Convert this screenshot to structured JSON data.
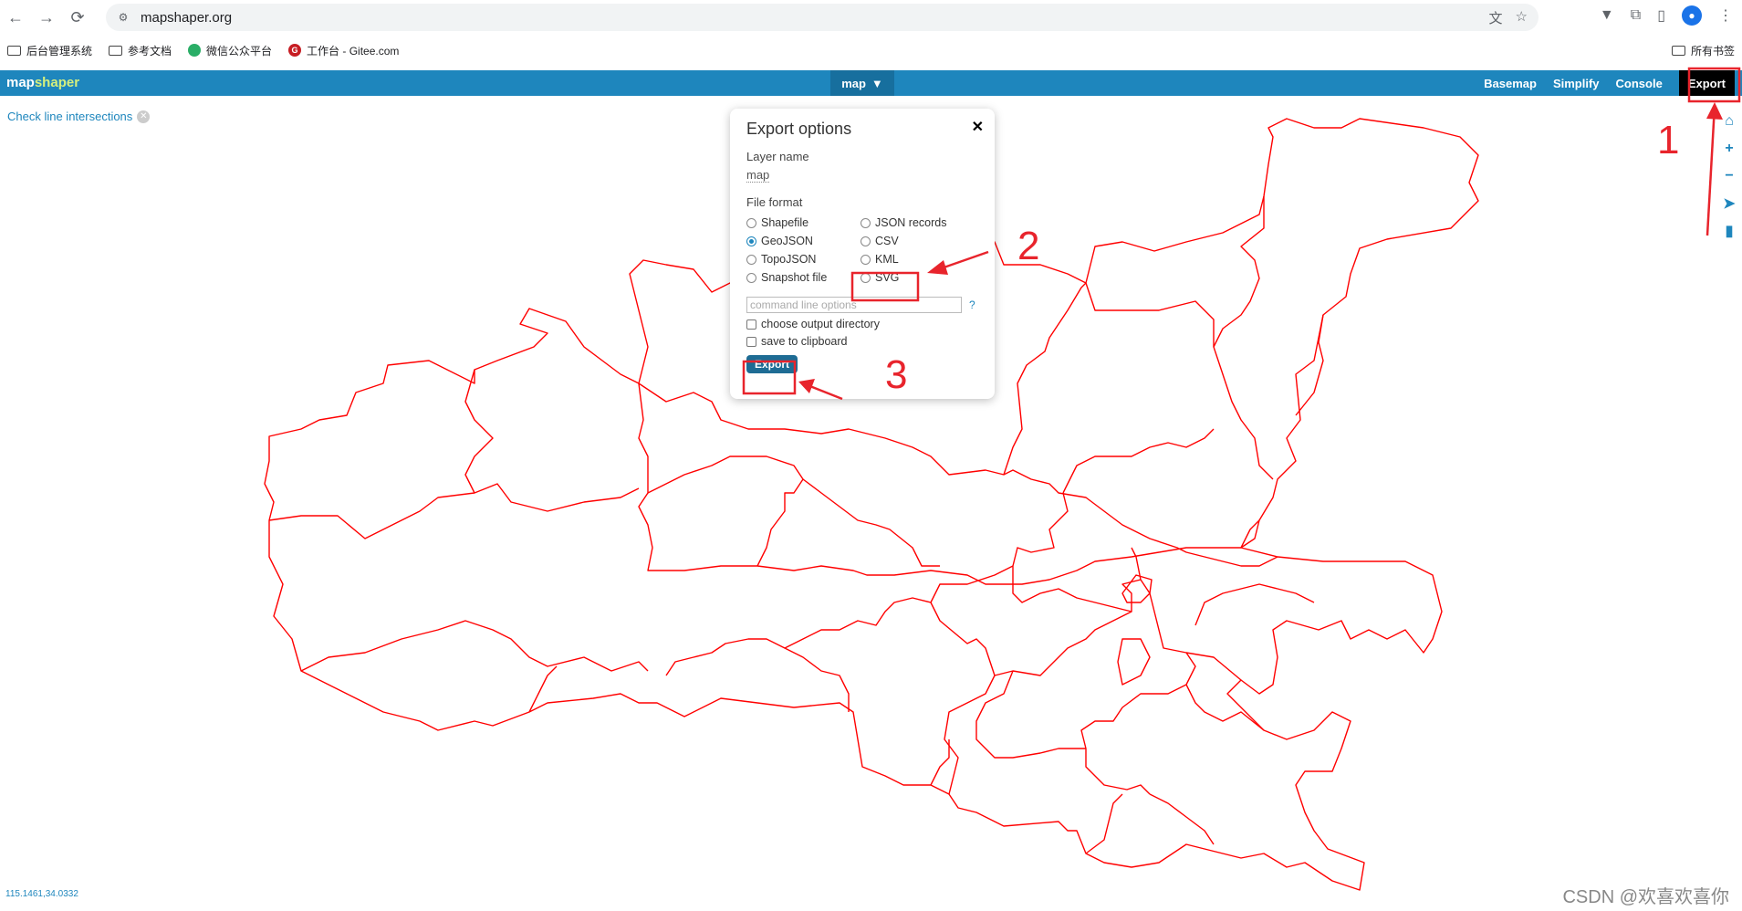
{
  "browser": {
    "url": "mapshaper.org",
    "bookmarks": [
      "后台管理系统",
      "参考文档",
      "微信公众平台",
      "工作台 - Gitee.com"
    ],
    "bookmarks_right": "所有书签"
  },
  "app": {
    "logo_a": "map",
    "logo_b": "shaper",
    "layer_button": "map",
    "menu": {
      "basemap": "Basemap",
      "simplify": "Simplify",
      "console": "Console",
      "export": "Export"
    },
    "check_link": "Check line intersections",
    "coords": "115.1461,34.0332"
  },
  "dialog": {
    "title": "Export options",
    "layer_name_label": "Layer name",
    "layer_name_value": "map",
    "file_format_label": "File format",
    "formats": [
      "Shapefile",
      "JSON records",
      "GeoJSON",
      "CSV",
      "TopoJSON",
      "KML",
      "Snapshot file",
      "SVG"
    ],
    "selected_format": "GeoJSON",
    "cmd_placeholder": "command line options",
    "help": "?",
    "choose_output_directory": "choose output directory",
    "save_to_clipboard": "save to clipboard",
    "export_button": "Export"
  },
  "annotations": {
    "n1": "1",
    "n2": "2",
    "n3": "3"
  },
  "watermark": "CSDN @欢喜欢喜你",
  "colors": {
    "header": "#1e86bd",
    "map_lines": "#ff0000",
    "annotation": "#e8242c"
  }
}
